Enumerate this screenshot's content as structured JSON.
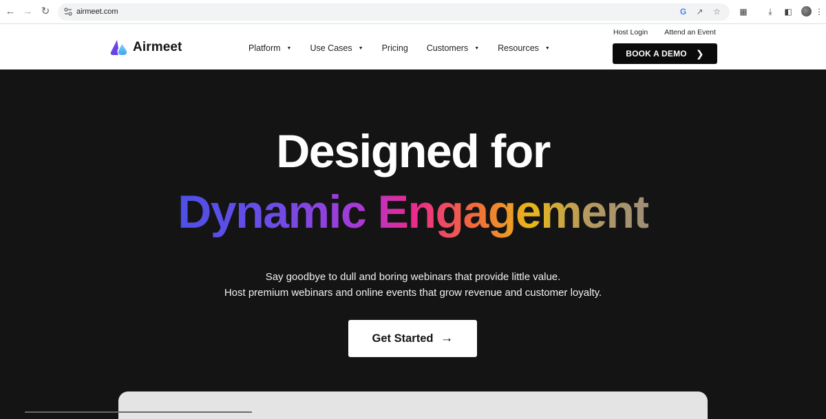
{
  "browser": {
    "url": "airmeet.com"
  },
  "header": {
    "brand": "Airmeet",
    "nav": [
      {
        "label": "Platform",
        "dropdown": true
      },
      {
        "label": "Use Cases",
        "dropdown": true
      },
      {
        "label": "Pricing",
        "dropdown": false
      },
      {
        "label": "Customers",
        "dropdown": true
      },
      {
        "label": "Resources",
        "dropdown": true
      }
    ],
    "host_login": "Host Login",
    "attend_event": "Attend an Event",
    "demo_label": "BOOK A DEMO"
  },
  "hero": {
    "title_line1": "Designed for",
    "title_line2": "Dynamic Engagement",
    "subtitle_line1": "Say goodbye to dull and boring webinars that provide little value.",
    "subtitle_line2": "Host premium webinars and online events that grow revenue and customer loyalty.",
    "cta_label": "Get Started"
  },
  "colors": {
    "hero_bg": "#141414",
    "brand_purple": "#6b4de6",
    "brand_blue": "#4fb8f0",
    "gradient": [
      "#4c50e6",
      "#a63ad8",
      "#e92a8f",
      "#f26b3a",
      "#e8b71a",
      "#9e8e78"
    ]
  }
}
